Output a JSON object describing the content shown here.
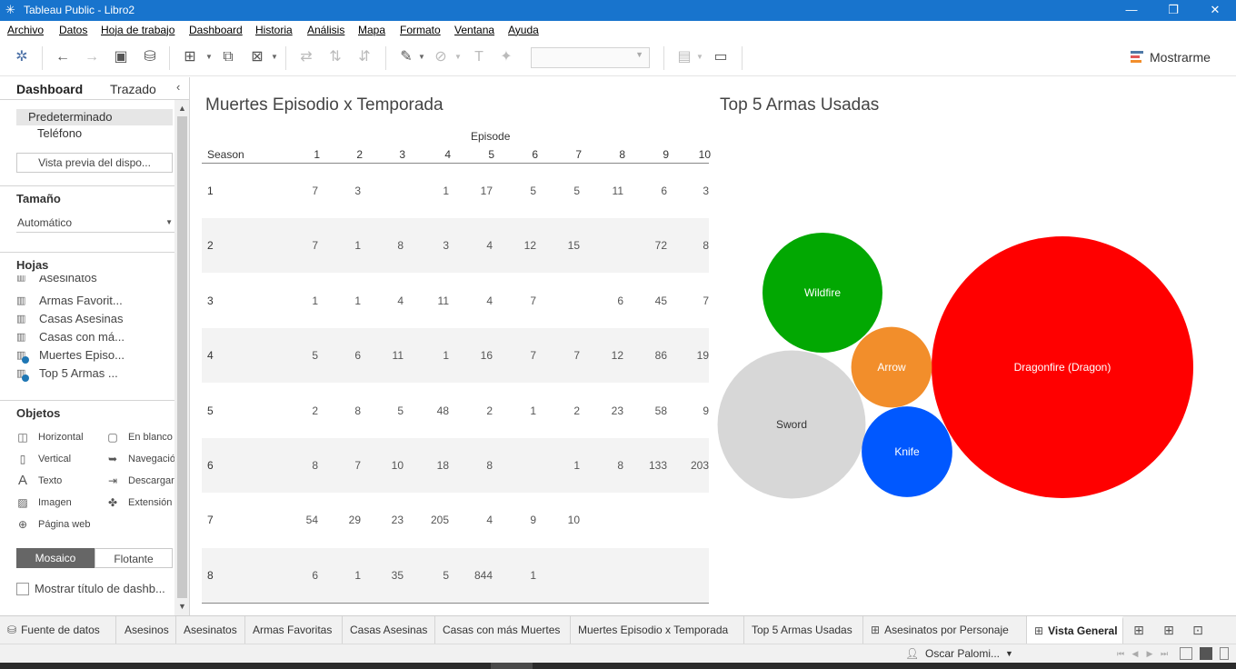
{
  "window": {
    "title": "Tableau Public - Libro2",
    "minimize": "—",
    "maximize": "❐",
    "close": "✕"
  },
  "menu": [
    "Archivo",
    "Datos",
    "Hoja de trabajo",
    "Dashboard",
    "Historia",
    "Análisis",
    "Mapa",
    "Formato",
    "Ventana",
    "Ayuda"
  ],
  "toolbar": {
    "show_me_label": "Mostrarme",
    "show_me_colors": [
      "#4e79a7",
      "#e15759",
      "#f28e2b"
    ],
    "icons": [
      "tableau-logo-icon",
      "undo-icon",
      "redo-icon",
      "save-icon",
      "new-datasource-icon",
      "new-sheet-icon",
      "duplicate-icon",
      "clear-icon",
      "swap-icon",
      "sort-asc-icon",
      "sort-desc-icon",
      "highlight-icon",
      "group-icon",
      "label-icon",
      "pin-icon",
      "show-cards-icon",
      "presentation-icon"
    ]
  },
  "left_panel": {
    "tab_dashboard": "Dashboard",
    "tab_layout": "Trazado",
    "devices": {
      "default": "Predeterminado",
      "phone": "Teléfono",
      "preview_button": "Vista previa del dispo..."
    },
    "size": {
      "title": "Tamaño",
      "value": "Automático"
    },
    "sheets": {
      "title": "Hojas",
      "items": [
        {
          "name": "Asesinatos",
          "in_use": false
        },
        {
          "name": "Armas Favorit...",
          "in_use": false
        },
        {
          "name": "Casas Asesinas",
          "in_use": false
        },
        {
          "name": "Casas con má...",
          "in_use": false
        },
        {
          "name": "Muertes Episo...",
          "in_use": true
        },
        {
          "name": "Top 5 Armas ...",
          "in_use": true
        }
      ]
    },
    "objects": {
      "title": "Objetos",
      "items": [
        {
          "label": "Horizontal",
          "icon": "horizontal-icon"
        },
        {
          "label": "En blanco",
          "icon": "blank-icon"
        },
        {
          "label": "Vertical",
          "icon": "vertical-icon"
        },
        {
          "label": "Navegació",
          "icon": "navigation-icon"
        },
        {
          "label": "Texto",
          "icon": "text-icon"
        },
        {
          "label": "Descargar",
          "icon": "download-icon"
        },
        {
          "label": "Imagen",
          "icon": "image-icon"
        },
        {
          "label": "Extensión",
          "icon": "extension-icon"
        },
        {
          "label": "Página web",
          "icon": "webpage-icon"
        }
      ]
    },
    "tiled": "Mosaico",
    "floating": "Flotante",
    "show_title": "Mostrar título de dashb..."
  },
  "dashboard": {
    "table_title": "Muertes Episodio x Temporada",
    "bubble_title": "Top 5 Armas Usadas",
    "episode_label": "Episode",
    "season_label": "Season",
    "episodes": [
      "1",
      "2",
      "3",
      "4",
      "5",
      "6",
      "7",
      "8",
      "9",
      "10"
    ],
    "rows": [
      {
        "season": "1",
        "values": [
          "7",
          "3",
          "",
          "1",
          "17",
          "5",
          "5",
          "11",
          "6",
          "3"
        ]
      },
      {
        "season": "2",
        "values": [
          "7",
          "1",
          "8",
          "3",
          "4",
          "12",
          "15",
          "",
          "72",
          "8"
        ]
      },
      {
        "season": "3",
        "values": [
          "1",
          "1",
          "4",
          "11",
          "4",
          "7",
          "",
          "6",
          "45",
          "7"
        ]
      },
      {
        "season": "4",
        "values": [
          "5",
          "6",
          "11",
          "1",
          "16",
          "7",
          "7",
          "12",
          "86",
          "19"
        ]
      },
      {
        "season": "5",
        "values": [
          "2",
          "8",
          "5",
          "48",
          "2",
          "1",
          "2",
          "23",
          "58",
          "9"
        ]
      },
      {
        "season": "6",
        "values": [
          "8",
          "7",
          "10",
          "18",
          "8",
          "",
          "1",
          "8",
          "133",
          "203"
        ]
      },
      {
        "season": "7",
        "values": [
          "54",
          "29",
          "23",
          "205",
          "4",
          "9",
          "10",
          "",
          "",
          ""
        ]
      },
      {
        "season": "8",
        "values": [
          "6",
          "1",
          "35",
          "5",
          "844",
          "1",
          "",
          "",
          "",
          ""
        ]
      }
    ]
  },
  "chart_data": {
    "type": "bubble",
    "title": "Top 5 Armas Usadas",
    "series": [
      {
        "name": "Dragonfire (Dragon)",
        "relative_size": 1.0,
        "color": "#ff0000"
      },
      {
        "name": "Sword",
        "relative_size": 0.32,
        "color": "#d7d7d7"
      },
      {
        "name": "Wildfire",
        "relative_size": 0.21,
        "color": "#02a802"
      },
      {
        "name": "Knife",
        "relative_size": 0.12,
        "color": "#0058ff"
      },
      {
        "name": "Arrow",
        "relative_size": 0.095,
        "color": "#f28e2b"
      }
    ]
  },
  "sheet_tabs": {
    "data_source": "Fuente de datos",
    "tabs": [
      {
        "label": "Asesinos",
        "kind": "sheet",
        "active": false
      },
      {
        "label": "Asesinatos",
        "kind": "sheet",
        "active": false
      },
      {
        "label": "Armas Favoritas",
        "kind": "sheet",
        "active": false
      },
      {
        "label": "Casas Asesinas",
        "kind": "sheet",
        "active": false
      },
      {
        "label": "Casas con más Muertes",
        "kind": "sheet",
        "active": false
      },
      {
        "label": "Muertes Episodio x Temporada",
        "kind": "sheet",
        "active": false
      },
      {
        "label": "Top 5 Armas Usadas",
        "kind": "sheet",
        "active": false
      },
      {
        "label": "Asesinatos por Personaje",
        "kind": "dashboard",
        "active": false
      },
      {
        "label": "Vista General",
        "kind": "dashboard",
        "active": true
      }
    ]
  },
  "status": {
    "user": "Oscar Palomi..."
  }
}
